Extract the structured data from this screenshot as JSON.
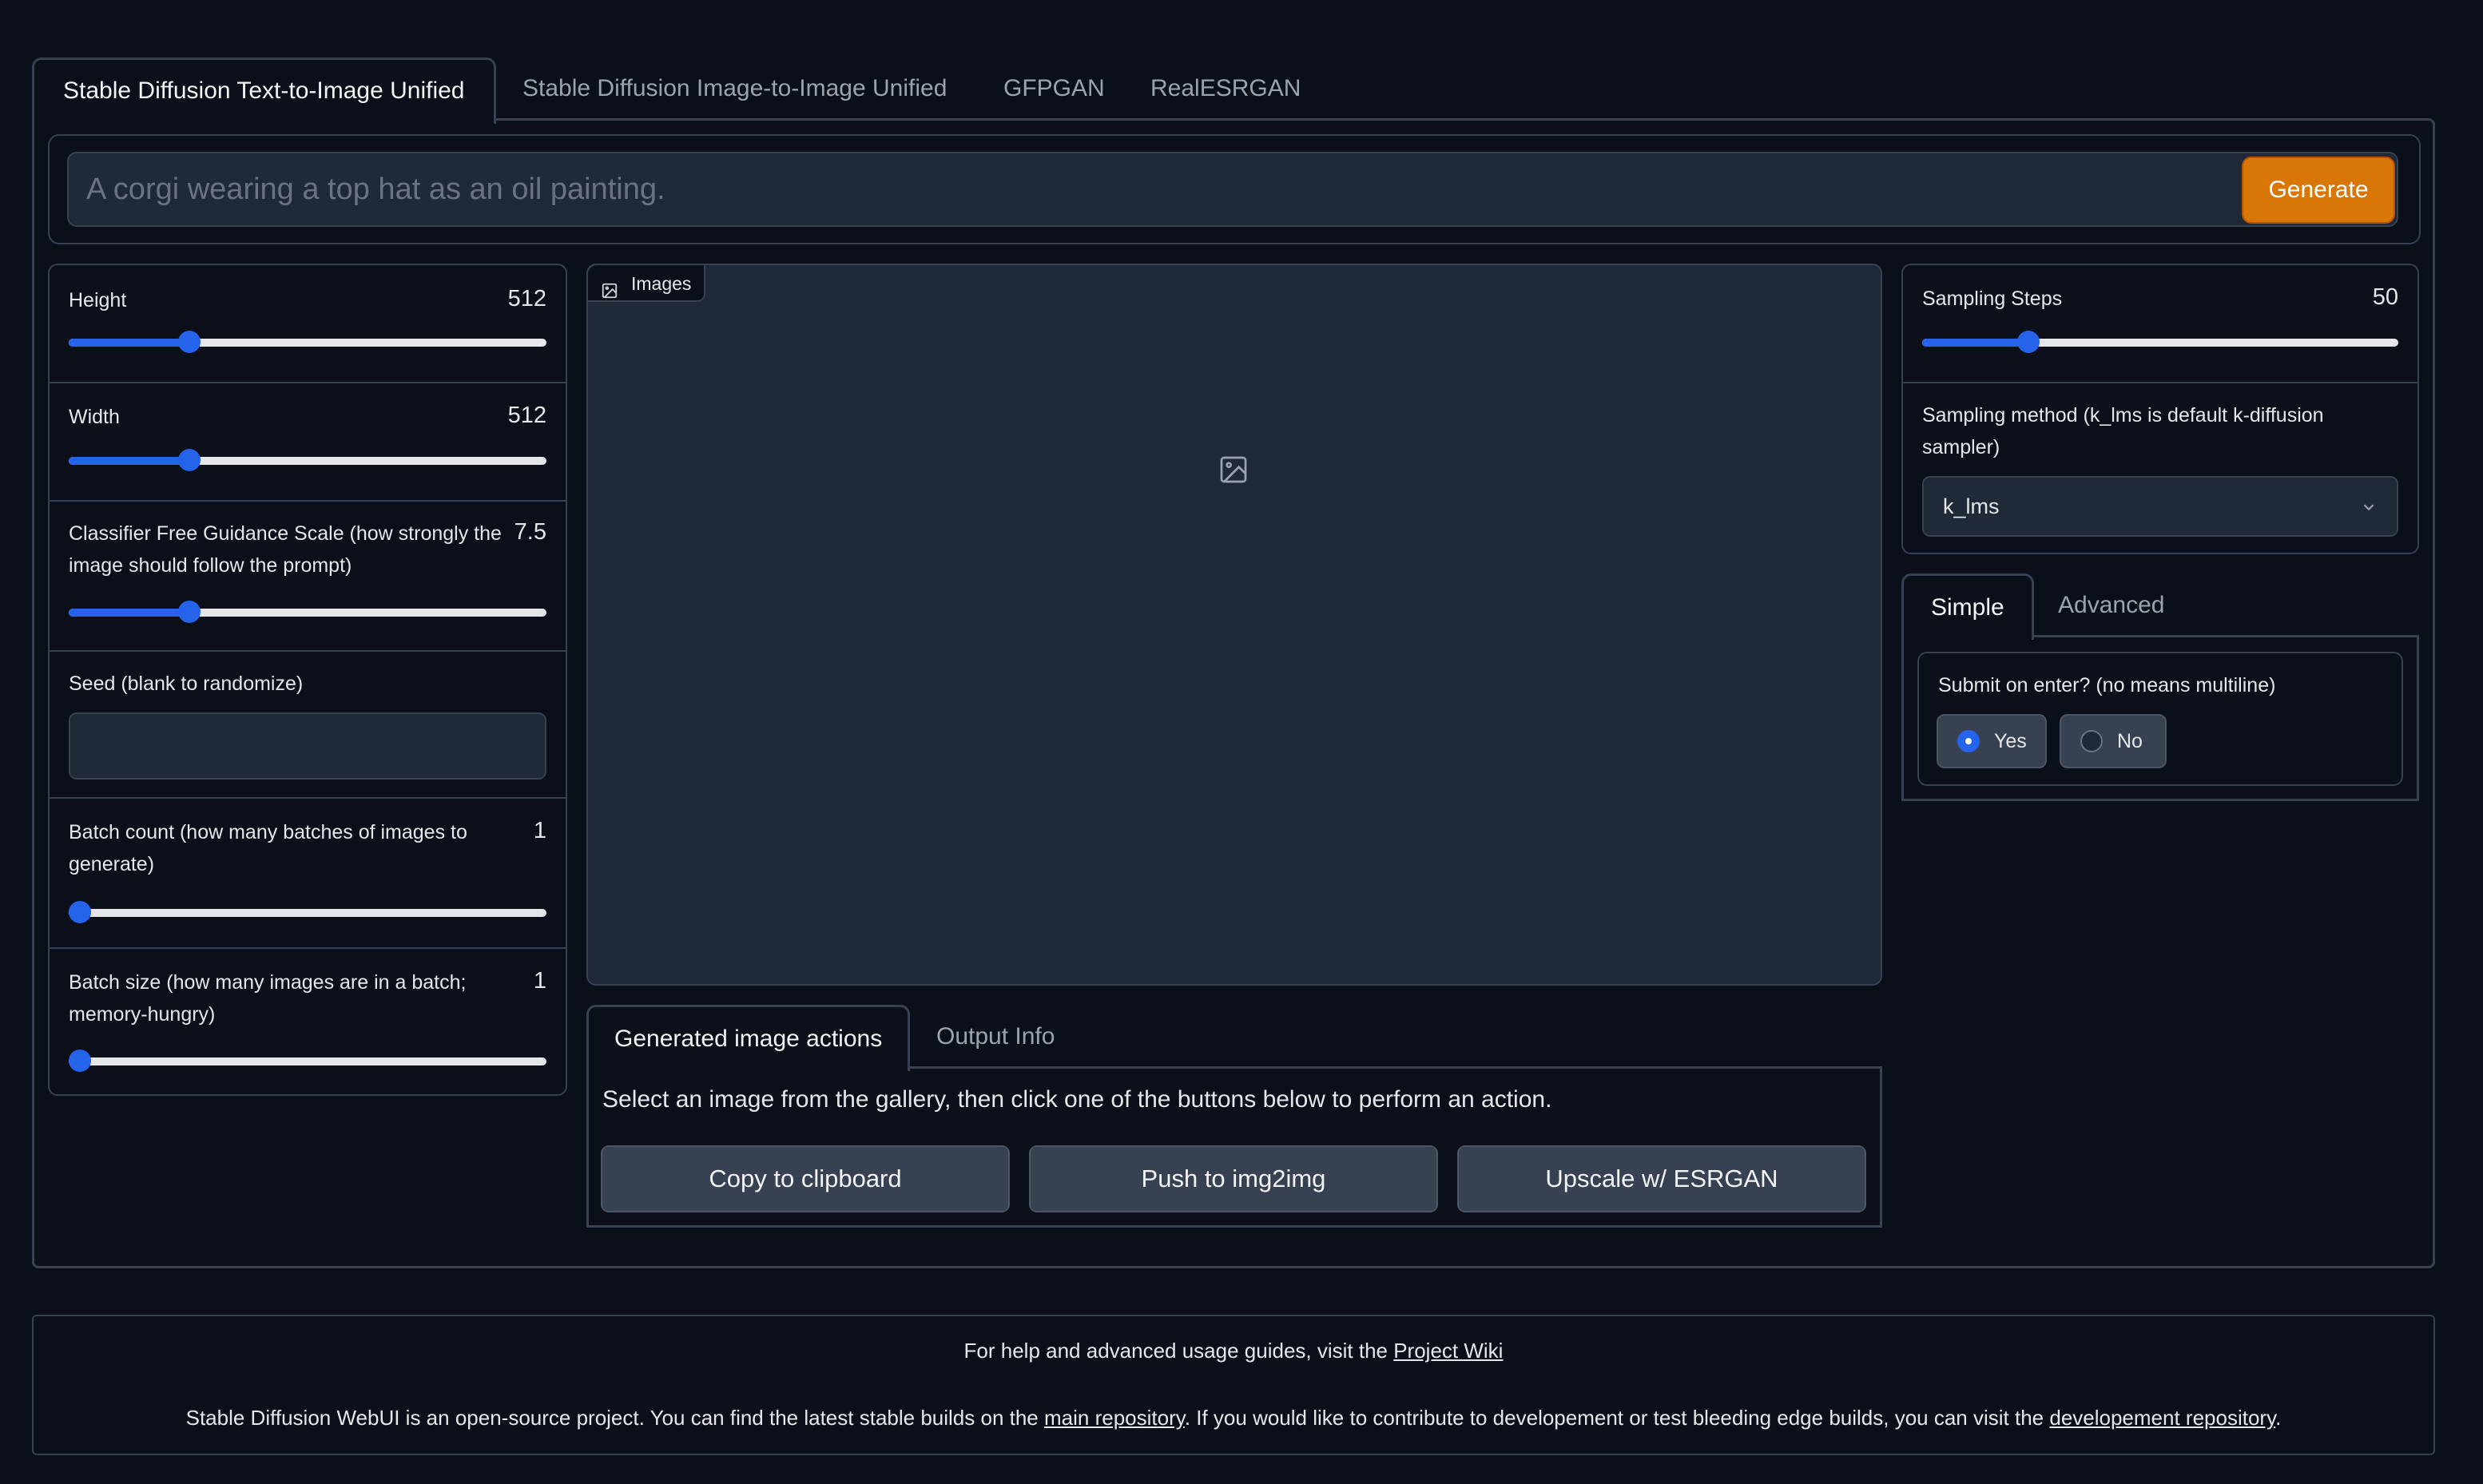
{
  "tabs": [
    {
      "label": "Stable Diffusion Text-to-Image Unified",
      "active": true
    },
    {
      "label": "Stable Diffusion Image-to-Image Unified",
      "active": false
    },
    {
      "label": "GFPGAN",
      "active": false
    },
    {
      "label": "RealESRGAN",
      "active": false
    }
  ],
  "prompt": {
    "placeholder": "A corgi wearing a top hat as an oil painting.",
    "value": ""
  },
  "generate_label": "Generate",
  "left_panel": {
    "height": {
      "label": "Height",
      "value": "512",
      "fraction": 0.24
    },
    "width": {
      "label": "Width",
      "value": "512",
      "fraction": 0.24
    },
    "cfg_scale": {
      "label": "Classifier Free Guidance Scale (how strongly the image should follow the prompt)",
      "value": "7.5",
      "fraction": 0.24
    },
    "seed": {
      "label": "Seed (blank to randomize)",
      "value": ""
    },
    "batch_count": {
      "label": "Batch count (how many batches of images to generate)",
      "value": "1",
      "fraction": 0.0
    },
    "batch_size": {
      "label": "Batch size (how many images are in a batch; memory-hungry)",
      "value": "1",
      "fraction": 0.0
    }
  },
  "gallery": {
    "label": "Images",
    "icon": "image-icon"
  },
  "output_tabs": [
    {
      "label": "Generated image actions",
      "active": true
    },
    {
      "label": "Output Info",
      "active": false
    }
  ],
  "actions": {
    "description": "Select an image from the gallery, then click one of the buttons below to perform an action.",
    "copy_label": "Copy to clipboard",
    "push_label": "Push to img2img",
    "upscale_label": "Upscale w/ ESRGAN"
  },
  "right_panel": {
    "sampling_steps": {
      "label": "Sampling Steps",
      "value": "50",
      "fraction": 0.21
    },
    "sampling_method": {
      "label": "Sampling method (k_lms is default k-diffusion sampler)",
      "value": "k_lms"
    }
  },
  "mode_tabs": [
    {
      "label": "Simple",
      "active": true
    },
    {
      "label": "Advanced",
      "active": false
    }
  ],
  "submit_on_enter": {
    "label": "Submit on enter? (no means multiline)",
    "options": [
      {
        "label": "Yes",
        "selected": true
      },
      {
        "label": "No",
        "selected": false
      }
    ]
  },
  "footer": {
    "line1_prefix": "For help and advanced usage guides, visit the ",
    "line1_link": "Project Wiki",
    "line2_part1": "Stable Diffusion WebUI is an open-source project. You can find the latest stable builds on the ",
    "line2_link1": "main repository",
    "line2_part2": ". If you would like to contribute to developement or test bleeding edge builds, you can visit the ",
    "line2_link2": "developement repository",
    "line2_part3": "."
  },
  "colors": {
    "background": "#0b0f19",
    "panel_border": "#374151",
    "accent": "#2563eb",
    "generate": "#d97706"
  }
}
